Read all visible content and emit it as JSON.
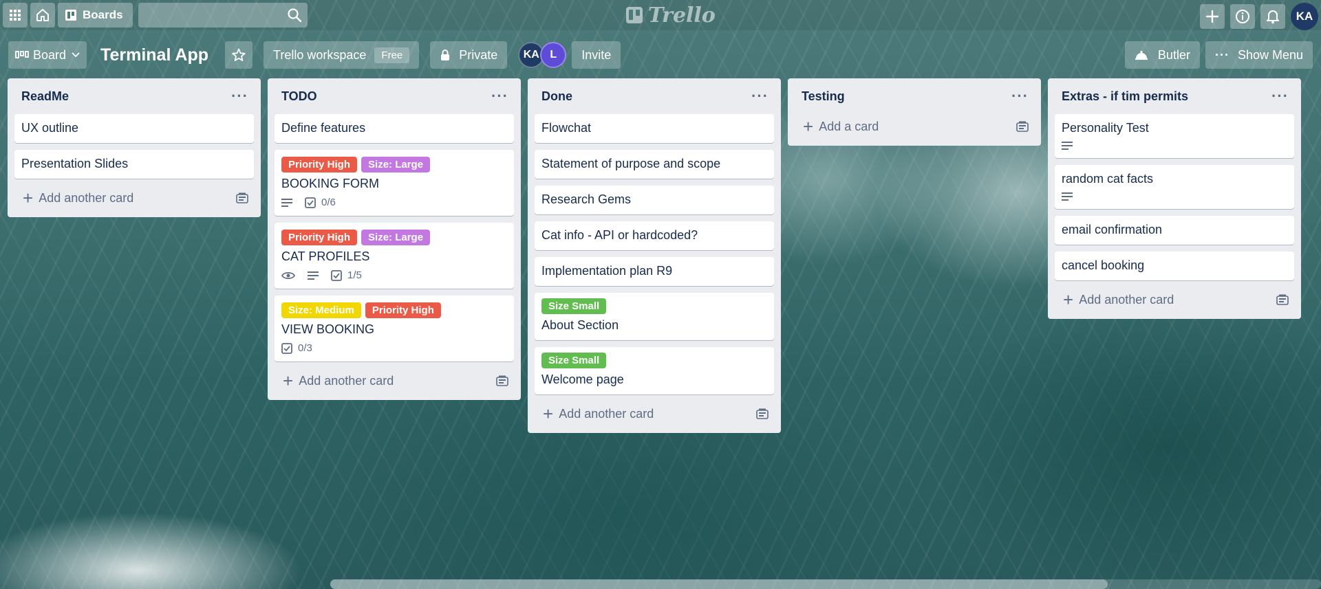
{
  "colors": {
    "label_red": "#eb5a46",
    "label_purple": "#c377e0",
    "label_yellow": "#f2d600",
    "label_green": "#61bd4f",
    "avatar_dark": "#1f3a64",
    "avatar_purple": "#5e4bd8"
  },
  "topbar": {
    "apps_icon": "grid-icon",
    "home_icon": "home-icon",
    "boards_label": "Boards",
    "search_placeholder": "",
    "logo_text": "Trello",
    "user_initials": "KA"
  },
  "board": {
    "view_label": "Board",
    "title": "Terminal App",
    "workspace_label": "Trello workspace",
    "workspace_tag": "Free",
    "visibility_label": "Private",
    "members": [
      "KA",
      "L"
    ],
    "invite_label": "Invite",
    "butler_label": "Butler",
    "menu_label": "Show Menu"
  },
  "lists": [
    {
      "title": "ReadMe",
      "cards": [
        {
          "title": "UX outline"
        },
        {
          "title": "Presentation Slides"
        }
      ],
      "add_label": "Add another card"
    },
    {
      "title": "TODO",
      "cards": [
        {
          "title": "Define features"
        },
        {
          "title": "BOOKING FORM",
          "labels": [
            "Priority High",
            "Size: Large"
          ],
          "checklist": "0/6"
        },
        {
          "title": "CAT PROFILES",
          "labels": [
            "Priority High",
            "Size: Large"
          ],
          "checklist": "1/5"
        },
        {
          "title": "VIEW BOOKING",
          "labels": [
            "Size: Medium",
            "Priority High"
          ],
          "checklist": "0/3"
        }
      ],
      "add_label": "Add another card"
    },
    {
      "title": "Done",
      "cards": [
        {
          "title": "Flowchat"
        },
        {
          "title": "Statement of purpose and scope"
        },
        {
          "title": "Research Gems"
        },
        {
          "title": "Cat info - API or hardcoded?"
        },
        {
          "title": "Implementation plan R9"
        },
        {
          "title": "About Section",
          "labels": [
            "Size Small"
          ]
        },
        {
          "title": "Welcome page",
          "labels": [
            "Size Small"
          ]
        }
      ],
      "add_label": "Add another card"
    },
    {
      "title": "Testing",
      "cards": [],
      "add_label": "Add a card"
    },
    {
      "title": "Extras - if tim permits",
      "cards": [
        {
          "title": "Personality Test"
        },
        {
          "title": "random cat facts"
        },
        {
          "title": "email confirmation"
        },
        {
          "title": "cancel booking"
        }
      ],
      "add_label": "Add another card"
    }
  ]
}
